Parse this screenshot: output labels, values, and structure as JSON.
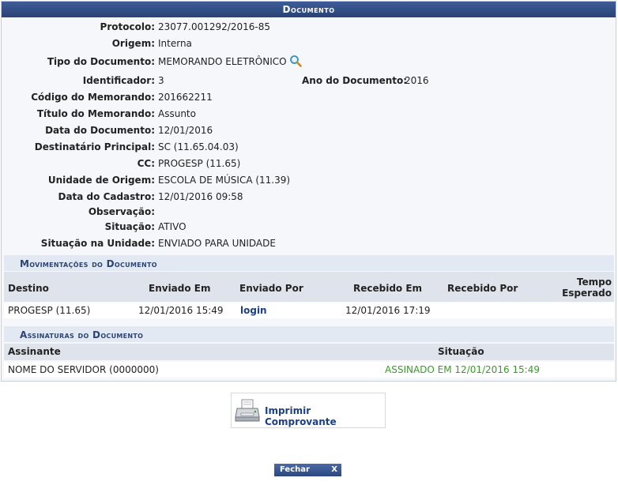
{
  "panel": {
    "title": "Documento"
  },
  "fields": {
    "protocolo": {
      "label": "Protocolo:",
      "value": "23077.001292/2016-85"
    },
    "origem": {
      "label": "Origem:",
      "value": "Interna"
    },
    "tipo": {
      "label": "Tipo do Documento:",
      "value": "MEMORANDO ELETRÔNICO",
      "icon": "magnifier-icon"
    },
    "identificador": {
      "label": "Identificador:",
      "value": "3"
    },
    "ano": {
      "label": "Ano do Documento:",
      "value": "2016"
    },
    "codigo": {
      "label": "Código do Memorando:",
      "value": "201662211"
    },
    "titulo": {
      "label": "Título do Memorando:",
      "value": "Assunto"
    },
    "data": {
      "label": "Data do Documento:",
      "value": "12/01/2016"
    },
    "destinatario": {
      "label": "Destinatário Principal:",
      "value": "SC (11.65.04.03)"
    },
    "cc": {
      "label": "CC:",
      "value": "PROGESP (11.65)"
    },
    "unidade": {
      "label": "Unidade de Origem:",
      "value": "ESCOLA DE MÚSICA (11.39)"
    },
    "cadastro": {
      "label": "Data do Cadastro:",
      "value": "12/01/2016 09:58"
    },
    "observacao": {
      "label": "Observação:",
      "value": ""
    },
    "situacao": {
      "label": "Situação:",
      "value": "ATIVO"
    },
    "situacao_unidade": {
      "label": "Situação na Unidade:",
      "value": "ENVIADO PARA UNIDADE"
    }
  },
  "movimentacoes": {
    "title": "Movimentações do Documento",
    "headers": {
      "destino": "Destino",
      "enviado_em": "Enviado Em",
      "enviado_por": "Enviado Por",
      "recebido_em": "Recebido Em",
      "recebido_por": "Recebido Por",
      "tempo_1": "Tempo",
      "tempo_2": "Esperado"
    },
    "rows": [
      {
        "destino": "PROGESP (11.65)",
        "enviado_em": "12/01/2016 15:49",
        "enviado_por": "login",
        "recebido_em": "12/01/2016 17:19",
        "recebido_por": "",
        "tempo": ""
      }
    ]
  },
  "assinaturas": {
    "title": "Assinaturas do Documento",
    "headers": {
      "assinante": "Assinante",
      "situacao": "Situação"
    },
    "rows": [
      {
        "assinante": "NOME DO SERVIDOR (0000000)",
        "situacao": "ASSINADO EM 12/01/2016 15:49"
      }
    ]
  },
  "actions": {
    "print_label": "Imprimir Comprovante",
    "close_label": "Fechar",
    "close_x": "X"
  },
  "colors": {
    "header_blue": "#2a4376",
    "link_blue": "#1c3f85",
    "signed_green": "#3a9a2a"
  }
}
